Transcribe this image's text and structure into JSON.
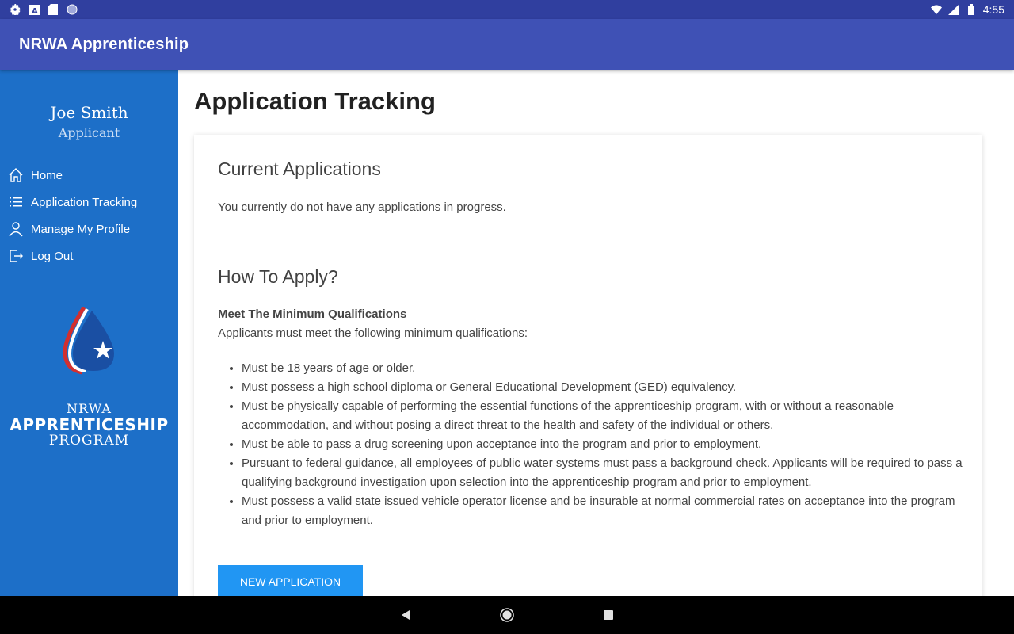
{
  "status_bar": {
    "time": "4:55",
    "left_icons": [
      "settings-icon",
      "font-icon",
      "sd-card-icon",
      "circle-icon"
    ],
    "right_icons": [
      "wifi-icon",
      "signal-icon",
      "battery-icon"
    ]
  },
  "app_bar": {
    "title": "NRWA Apprenticeship"
  },
  "sidebar": {
    "user_name": "Joe Smith",
    "user_role": "Applicant",
    "items": [
      {
        "label": "Home",
        "icon": "home-icon"
      },
      {
        "label": "Application Tracking",
        "icon": "list-icon"
      },
      {
        "label": "Manage My Profile",
        "icon": "person-icon"
      },
      {
        "label": "Log Out",
        "icon": "logout-icon"
      }
    ],
    "logo": {
      "line1": "NRWA",
      "line2": "APPRENTICESHIP",
      "line3": "PROGRAM"
    }
  },
  "main": {
    "page_title": "Application Tracking",
    "current": {
      "title": "Current Applications",
      "text": "You currently do not have any applications in progress."
    },
    "how_to": {
      "title": "How To Apply?",
      "subtitle": "Meet The Minimum Qualifications",
      "intro": "Applicants must meet the following minimum qualifications:",
      "qualifications": [
        "Must be 18 years of age or older.",
        "Must possess a high school diploma or General Educational Development (GED) equivalency.",
        "Must be physically capable of performing the essential functions of the apprenticeship program, with or without a reasonable accommodation, and without posing a direct threat to the health and safety of the individual or others.",
        "Must be able to pass a drug screening upon acceptance into the program and prior to employment.",
        "Pursuant to federal guidance, all employees of public water systems must pass a background check.  Applicants will be required to pass a qualifying background investigation upon selection into the apprenticeship program and prior to employment.",
        "Must possess a valid state issued vehicle operator license and be insurable at normal commercial rates on acceptance into the program and prior to employment."
      ]
    },
    "button_label": "New Application"
  },
  "colors": {
    "status_bar": "#303f9f",
    "app_bar": "#3f51b5",
    "sidebar": "#1d6fc8",
    "button": "#2196f3"
  },
  "nav_bar": {
    "buttons": [
      "back-icon",
      "home-circle-icon",
      "recents-icon"
    ]
  }
}
